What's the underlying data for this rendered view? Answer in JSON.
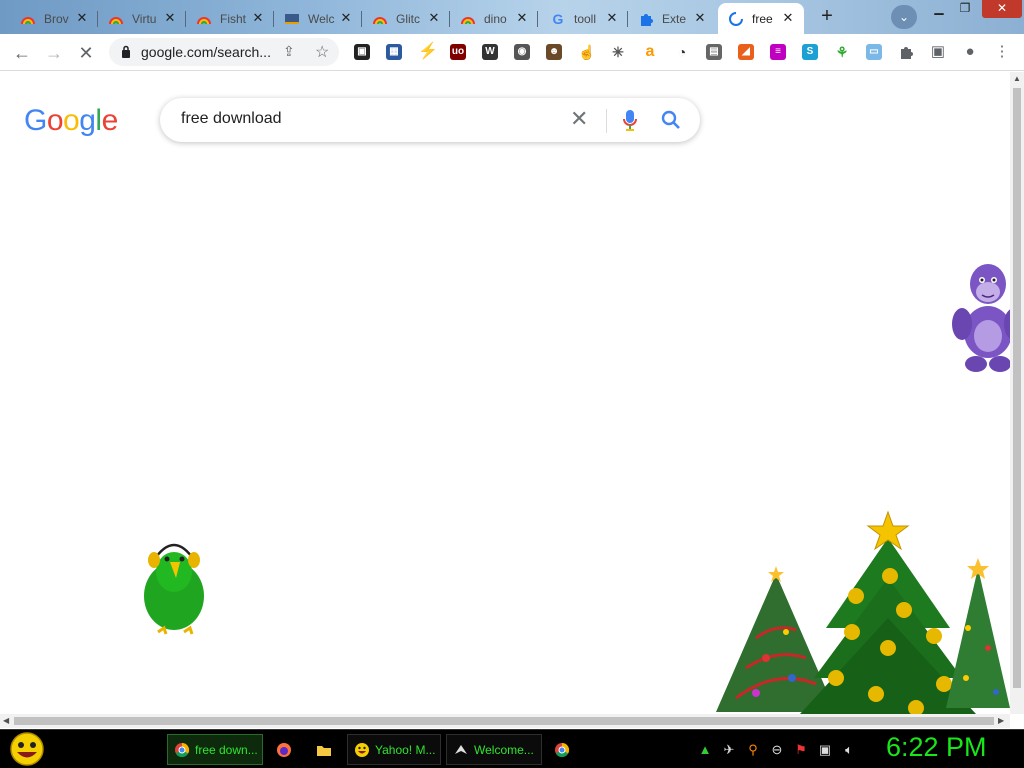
{
  "browser": {
    "tabs": [
      {
        "label": "Brov",
        "favicon": "chrome-rainbow-icon"
      },
      {
        "label": "Virtu",
        "favicon": "chrome-rainbow-icon"
      },
      {
        "label": "Fisht",
        "favicon": "chrome-rainbow-icon"
      },
      {
        "label": "Welc",
        "favicon": "page-icon"
      },
      {
        "label": "Glitc",
        "favicon": "chrome-rainbow-icon"
      },
      {
        "label": "dino",
        "favicon": "chrome-rainbow-icon"
      },
      {
        "label": "tooll",
        "favicon": "google-g-icon"
      },
      {
        "label": "Exte",
        "favicon": "puzzle-icon"
      },
      {
        "label": "free",
        "favicon": "loading-spinner-icon",
        "active": true
      }
    ],
    "new_tab_label": "+",
    "url": "google.com/search...",
    "colors": {
      "accent": "#1a73e8",
      "tab_strip": "#8fb6da"
    }
  },
  "search": {
    "logo_letters": [
      "G",
      "o",
      "o",
      "g",
      "l",
      "e"
    ],
    "logo_colors": [
      "#4285f4",
      "#ea4335",
      "#fbbc05",
      "#4285f4",
      "#34a853",
      "#ea4335"
    ],
    "query": "free download"
  },
  "taskbar": {
    "tasks": [
      {
        "label": "free down...",
        "icon": "chrome-icon",
        "active": true
      },
      {
        "label": "",
        "icon": "firefox-icon"
      },
      {
        "label": "",
        "icon": "folder-icon"
      },
      {
        "label": "Yahoo! M...",
        "icon": "yahoo-smiley-icon"
      },
      {
        "label": "Welcome...",
        "icon": "bird-icon"
      },
      {
        "label": "",
        "icon": "chrome-icon"
      }
    ],
    "clock": "6:22 PM",
    "clock_color": "#19e619"
  }
}
